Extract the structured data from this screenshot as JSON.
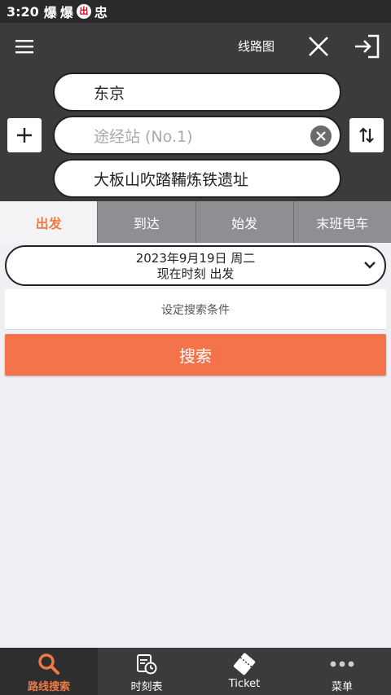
{
  "statusbar": {
    "time": "3:20",
    "icons": [
      "爆",
      "爆",
      "出",
      "忠"
    ]
  },
  "appbar": {
    "route_map_label": "线路图"
  },
  "stations": {
    "from": "东京",
    "via_placeholder": "途经站 (No.1)",
    "to": "大板山吹踏鞴炼铁遗址"
  },
  "tabs": [
    {
      "label": "出发"
    },
    {
      "label": "到达"
    },
    {
      "label": "始发"
    },
    {
      "label": "末班电车"
    }
  ],
  "datetime": {
    "date": "2023年9月19日 周二",
    "mode": "现在时刻 出发"
  },
  "condition_label": "设定搜索条件",
  "search_label": "搜索",
  "bottomnav": [
    {
      "label": "路线搜索",
      "icon": "search-icon"
    },
    {
      "label": "时刻表",
      "icon": "timetable-icon"
    },
    {
      "label": "Ticket",
      "icon": "ticket-icon"
    },
    {
      "label": "菜单",
      "icon": "more-icon"
    }
  ],
  "colors": {
    "accent": "#f5734a",
    "dark": "#3b3b3b",
    "tab_inactive": "#8e8e93"
  }
}
